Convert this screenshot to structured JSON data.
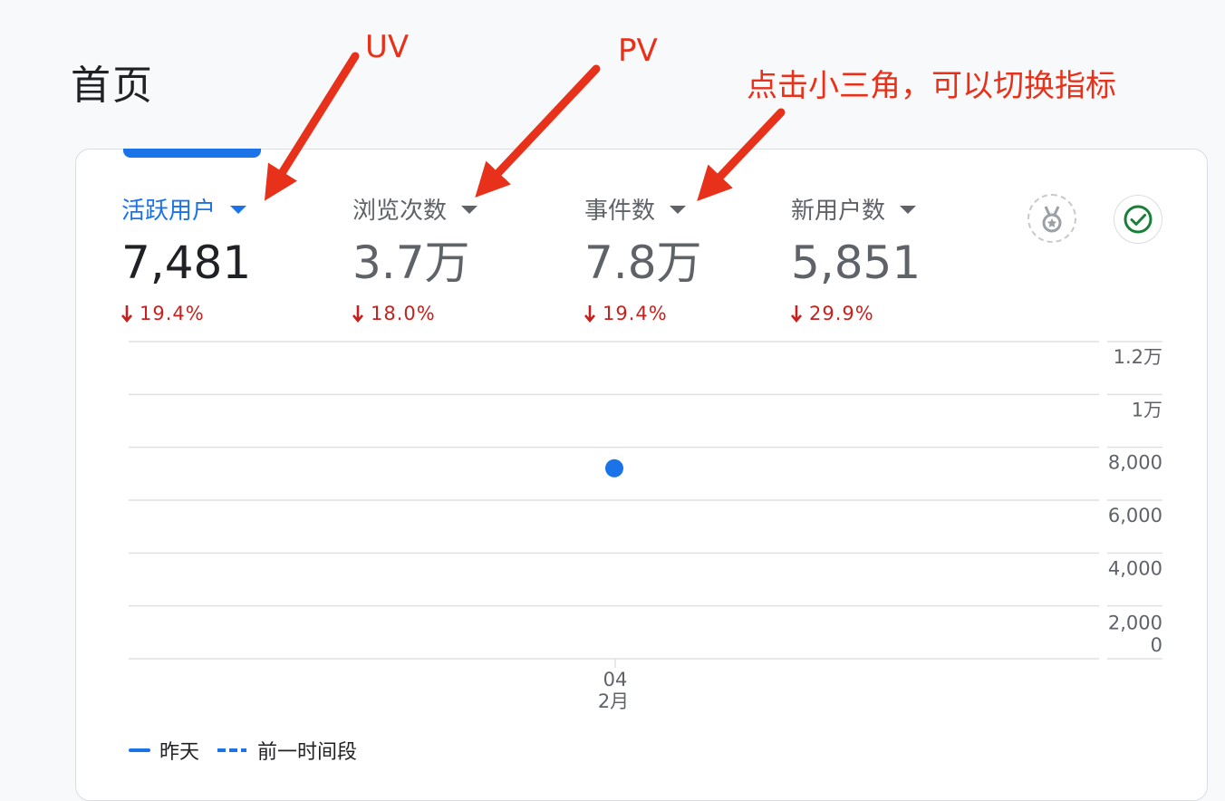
{
  "page": {
    "title": "首页"
  },
  "annotations": {
    "uv": "UV",
    "pv": "PV",
    "hint": "点击小三角，可以切换指标"
  },
  "metrics": [
    {
      "label": "活跃用户",
      "value": "7,481",
      "change": "19.4%",
      "direction": "down",
      "active": true
    },
    {
      "label": "浏览次数",
      "value": "3.7万",
      "change": "18.0%",
      "direction": "down",
      "active": false
    },
    {
      "label": "事件数",
      "value": "7.8万",
      "change": "19.4%",
      "direction": "down",
      "active": false
    },
    {
      "label": "新用户数",
      "value": "5,851",
      "change": "29.9%",
      "direction": "down",
      "active": false
    }
  ],
  "icons": {
    "medal": "medal-icon",
    "check": "check-circle-icon"
  },
  "colors": {
    "accent": "#1a73e8",
    "negative": "#c5221f",
    "annotation": "#e8311a",
    "success": "#188038"
  },
  "chart_data": {
    "type": "scatter",
    "x_ticks": [
      {
        "day": "04",
        "month": "2月"
      }
    ],
    "y_ticks": [
      "1.2万",
      "1万",
      "8,000",
      "6,000",
      "4,000",
      "2,000",
      "0"
    ],
    "ylim": [
      0,
      12000
    ],
    "series": [
      {
        "name": "昨天",
        "style": "solid",
        "x": [
          "04"
        ],
        "values": [
          7481
        ]
      }
    ],
    "legend": [
      {
        "label": "昨天",
        "style": "solid"
      },
      {
        "label": "前一时间段",
        "style": "dashed"
      }
    ],
    "grid": true,
    "legend_position": "bottom-left"
  }
}
